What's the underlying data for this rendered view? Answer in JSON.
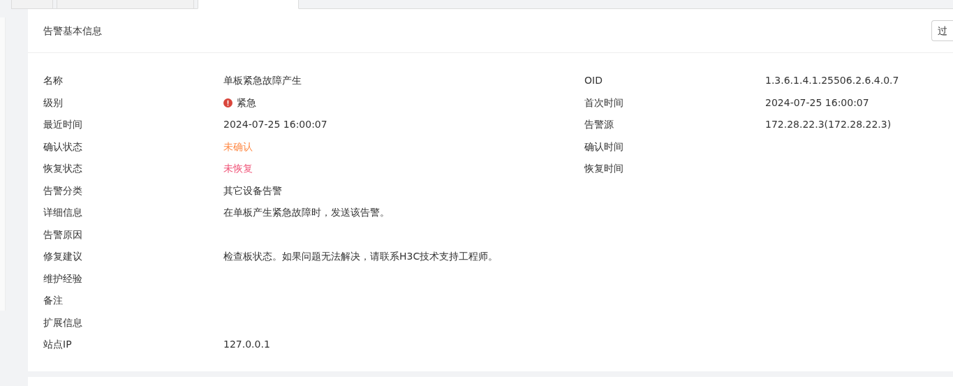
{
  "tabs": [
    {
      "selected": false
    },
    {
      "selected": false
    },
    {
      "selected": true
    }
  ],
  "card": {
    "title": "告警基本信息",
    "button": "过"
  },
  "left_fields": [
    {
      "label": "名称",
      "value": "单板紧急故障产生",
      "kind": "text"
    },
    {
      "label": "级别",
      "value": "紧急",
      "kind": "severity",
      "color": "#d9453b"
    },
    {
      "label": "最近时间",
      "value": "2024-07-25 16:00:07",
      "kind": "text"
    },
    {
      "label": "确认状态",
      "value": "未确认",
      "kind": "status",
      "color": "#ff8c4a"
    },
    {
      "label": "恢复状态",
      "value": "未恢复",
      "kind": "status",
      "color": "#f0567a"
    },
    {
      "label": "告警分类",
      "value": "其它设备告警",
      "kind": "text"
    },
    {
      "label": "详细信息",
      "value": "在单板产生紧急故障时，发送该告警。",
      "kind": "text"
    },
    {
      "label": "告警原因"
    },
    {
      "label": "修复建议",
      "value": "检查板状态。如果问题无法解决，请联系H3C技术支持工程师。",
      "kind": "text"
    },
    {
      "label": "维护经验"
    },
    {
      "label": "备注"
    },
    {
      "label": "扩展信息"
    },
    {
      "label": "站点IP",
      "value": "127.0.0.1",
      "kind": "text"
    }
  ],
  "right_fields": [
    {
      "label": "OID",
      "value": "1.3.6.1.4.1.25506.2.6.4.0.7"
    },
    {
      "label": "首次时间",
      "value": "2024-07-25 16:00:07"
    },
    {
      "label": "告警源",
      "value": "172.28.22.3(172.28.22.3)"
    },
    {
      "label": "确认时间"
    },
    {
      "label": "恢复时间"
    }
  ]
}
